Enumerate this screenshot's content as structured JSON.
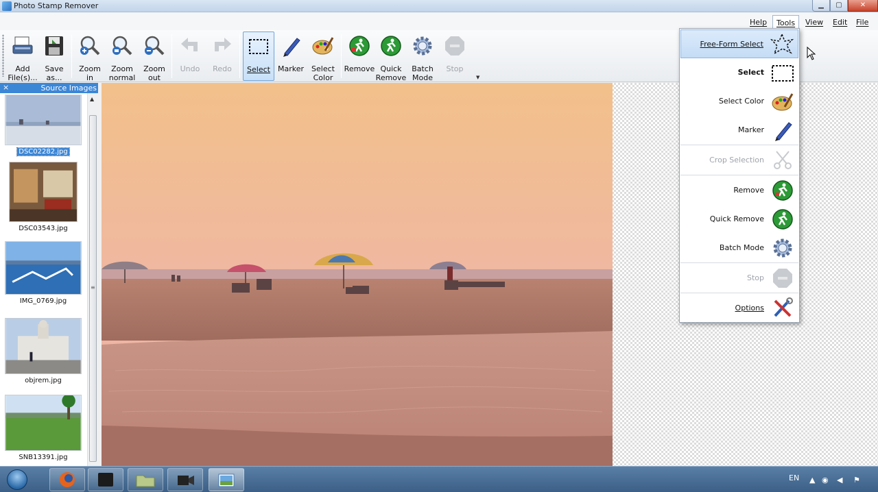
{
  "window": {
    "title": "Photo Stamp Remover"
  },
  "menu": {
    "items": [
      "Help",
      "Tools",
      "View",
      "Edit",
      "File"
    ]
  },
  "toolbar": {
    "add": "Add\nFile(s)...",
    "save": "Save\nas...",
    "zoom_in": "Zoom\nin",
    "zoom_normal": "Zoom\nnormal",
    "zoom_out": "Zoom\nout",
    "undo": "Undo",
    "redo": "Redo",
    "select": "Select",
    "marker": "Marker",
    "select_color": "Select\nColor",
    "remove": "Remove",
    "quick_remove": "Quick\nRemove",
    "batch_mode": "Batch\nMode",
    "stop": "Stop"
  },
  "source_images": {
    "title": "Source Images",
    "close": "×",
    "files": [
      "DSC02282.jpg",
      "DSC03543.jpg",
      "IMG_0769.jpg",
      "objrem.jpg",
      "SNB13391.jpg"
    ],
    "selected": "DSC02282.jpg"
  },
  "tools_menu": {
    "items": [
      "Free-Form Select",
      "Select",
      "Select Color",
      "Marker",
      "Crop Selection",
      "Remove",
      "Quick Remove",
      "Batch Mode",
      "Stop",
      "Options"
    ],
    "highlighted": "Free-Form Select",
    "disabled": [
      "Crop Selection",
      "Stop"
    ]
  },
  "taskbar": {
    "language": "EN"
  },
  "colors": {
    "accent": "#3c86d6",
    "menu_highlight": "#c4dcf6",
    "titlebar": "#c2d5ea"
  }
}
